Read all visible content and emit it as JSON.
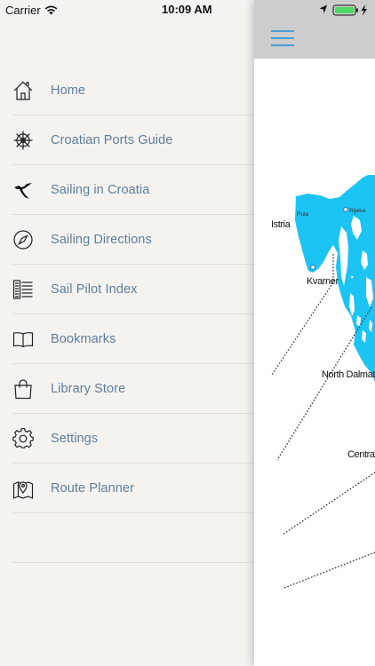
{
  "status_bar": {
    "carrier": "Carrier",
    "time": "10:09 AM"
  },
  "menu": {
    "items": [
      {
        "label": "Home",
        "icon": "home-icon"
      },
      {
        "label": "Croatian Ports Guide",
        "icon": "ship-wheel-icon"
      },
      {
        "label": "Sailing in Croatia",
        "icon": "croatia-map-icon"
      },
      {
        "label": "Sailing Directions",
        "icon": "compass-icon"
      },
      {
        "label": "Sail Pilot Index",
        "icon": "index-list-icon"
      },
      {
        "label": "Bookmarks",
        "icon": "book-icon"
      },
      {
        "label": "Library Store",
        "icon": "shopping-bag-icon"
      },
      {
        "label": "Settings",
        "icon": "gear-icon"
      },
      {
        "label": "Route Planner",
        "icon": "map-pin-icon"
      }
    ]
  },
  "map": {
    "labels": {
      "istria": "Istria",
      "kvarner": "Kvarner",
      "north_dalmatia": "North Dalmatia",
      "central": "Central",
      "rijeka": "Rijeka",
      "pula": "Pula"
    },
    "sea_color": "#1cc4f4"
  },
  "colors": {
    "menu_text": "#5e7e9e",
    "accent": "#4a9ed6",
    "battery": "#4cd964"
  }
}
